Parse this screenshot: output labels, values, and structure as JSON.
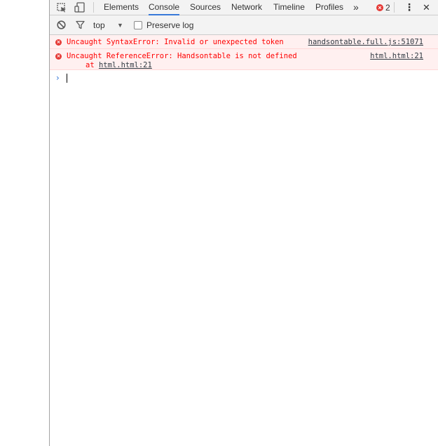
{
  "tabs": [
    {
      "label": "Elements",
      "selected": false
    },
    {
      "label": "Console",
      "selected": true
    },
    {
      "label": "Sources",
      "selected": false
    },
    {
      "label": "Network",
      "selected": false
    },
    {
      "label": "Timeline",
      "selected": false
    },
    {
      "label": "Profiles",
      "selected": false
    }
  ],
  "toolbar": {
    "more_tabs": "»",
    "error_count": "2",
    "menu": "⋮",
    "close": "✕"
  },
  "console_toolbar": {
    "context": "top",
    "context_dropdown": "▼",
    "preserve_log_label": "Preserve log",
    "preserve_log_checked": false
  },
  "messages": [
    {
      "level": "error",
      "text": "Uncaught SyntaxError: Invalid or unexpected token",
      "source": "handsontable.full.js:51071"
    },
    {
      "level": "error",
      "text": "Uncaught ReferenceError: Handsontable is not defined",
      "source": "html.html:21",
      "stack_prefix": "at ",
      "stack_link": "html.html:21"
    }
  ],
  "prompt": {
    "symbol": "›"
  },
  "colors": {
    "accent": "#3879d9",
    "error_text": "#ff0000",
    "error_bg": "#fff0f0",
    "error_icon": "#e53935",
    "toolbar_bg": "#f3f3f3"
  },
  "icons": {
    "inspect": "inspect-element-icon",
    "device": "device-toolbar-icon",
    "clear": "clear-console-icon",
    "filter": "filter-icon",
    "error": "error-icon"
  }
}
